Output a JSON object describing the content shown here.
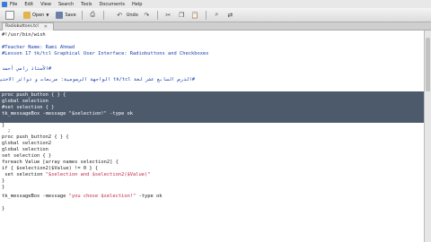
{
  "menu": {
    "items": [
      "File",
      "Edit",
      "View",
      "Search",
      "Tools",
      "Documents",
      "Help"
    ]
  },
  "toolbar": {
    "open_label": "Open",
    "save_label": "Save",
    "undo_label": "Undo",
    "icons": [
      "new-icon",
      "open-icon",
      "save-icon",
      "print-icon",
      "undo-icon",
      "redo-icon",
      "cut-icon",
      "copy-icon",
      "paste-icon",
      "find-icon",
      "replace-icon"
    ]
  },
  "tab": {
    "label": "Radiobuttons.tcl"
  },
  "code": {
    "l01": "#!/usr/bin/wish",
    "l02": "",
    "l03": "#Teacher Name: Rami Ahmad",
    "l04": "#Lesson 17 tk/tcl Graphical User Interface: Radiobuttons and Checkboxes",
    "l05": "",
    "l06": "#الأستاذ رامي أحمد",
    "l07": "#الدرس السابع عشر لغة tk/tcl الواجهة الرسومية: مربعات و دوائر الاختيار",
    "l08": "",
    "l09": "proc push_button { } {",
    "l10": "global selection",
    "l11": "#set selection { }",
    "l12": "tk_messageBox -message \"$selection!\" -type ok",
    "l13": "}",
    "l14": "  ;",
    "l15": "proc push_button2 { } {",
    "l16": "global selection2",
    "l17": "global selection",
    "l18": "set selection { }",
    "l19": "foreach Value [array names selection2] {",
    "l20": "if { $selection2($Value) != 0 } {",
    "l21_a": " set selection ",
    "l21_b": "\"$selection and $selection2($Value)\"",
    "l22": "}",
    "l23": "}",
    "l24_a": "tk_messageBox -message ",
    "l24_b": "\"you chose $selection!\"",
    "l24_c": " -type ok",
    "l25": "",
    "l26": "}"
  },
  "colors": {
    "selection": "#4d5a6b",
    "comment": "#1a3fae",
    "string": "#c0284a"
  }
}
